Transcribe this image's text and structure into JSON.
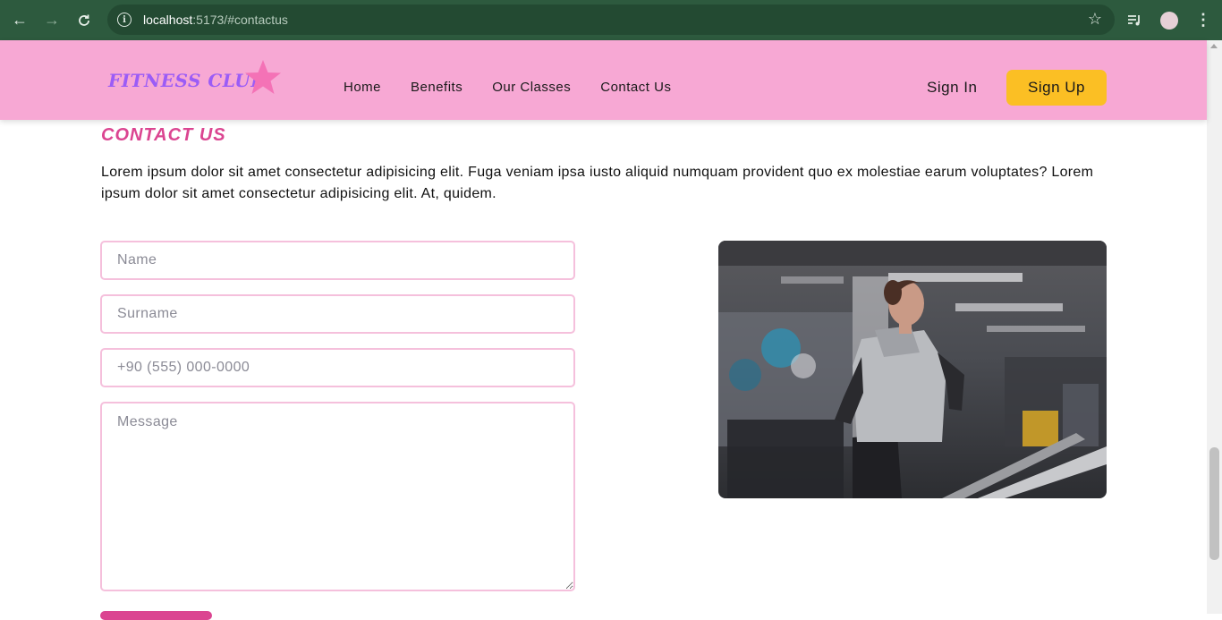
{
  "browser": {
    "url_host": "localhost",
    "url_rest": ":5173/#contactus"
  },
  "header": {
    "logo_text": "FITNESS CLUB",
    "nav": [
      "Home",
      "Benefits",
      "Our Classes",
      "Contact Us"
    ],
    "sign_in": "Sign In",
    "sign_up": "Sign Up",
    "colors": {
      "background": "#f7a8d4",
      "logo": "#9b5cf6",
      "star": "#f472b6",
      "cta": "#fbbf24"
    }
  },
  "contact": {
    "title": "CONTACT US",
    "text": "Lorem ipsum dolor sit amet consectetur adipisicing elit. Fuga veniam ipsa iusto aliquid numquam provident quo ex molestiae earum voluptates? Lorem ipsum dolor sit amet consectetur adipisicing elit. At, quidem.",
    "form": {
      "name_placeholder": "Name",
      "surname_placeholder": "Surname",
      "phone_placeholder": "+90 (555) 000-0000",
      "message_placeholder": "Message"
    },
    "accent_color": "#db4591"
  }
}
